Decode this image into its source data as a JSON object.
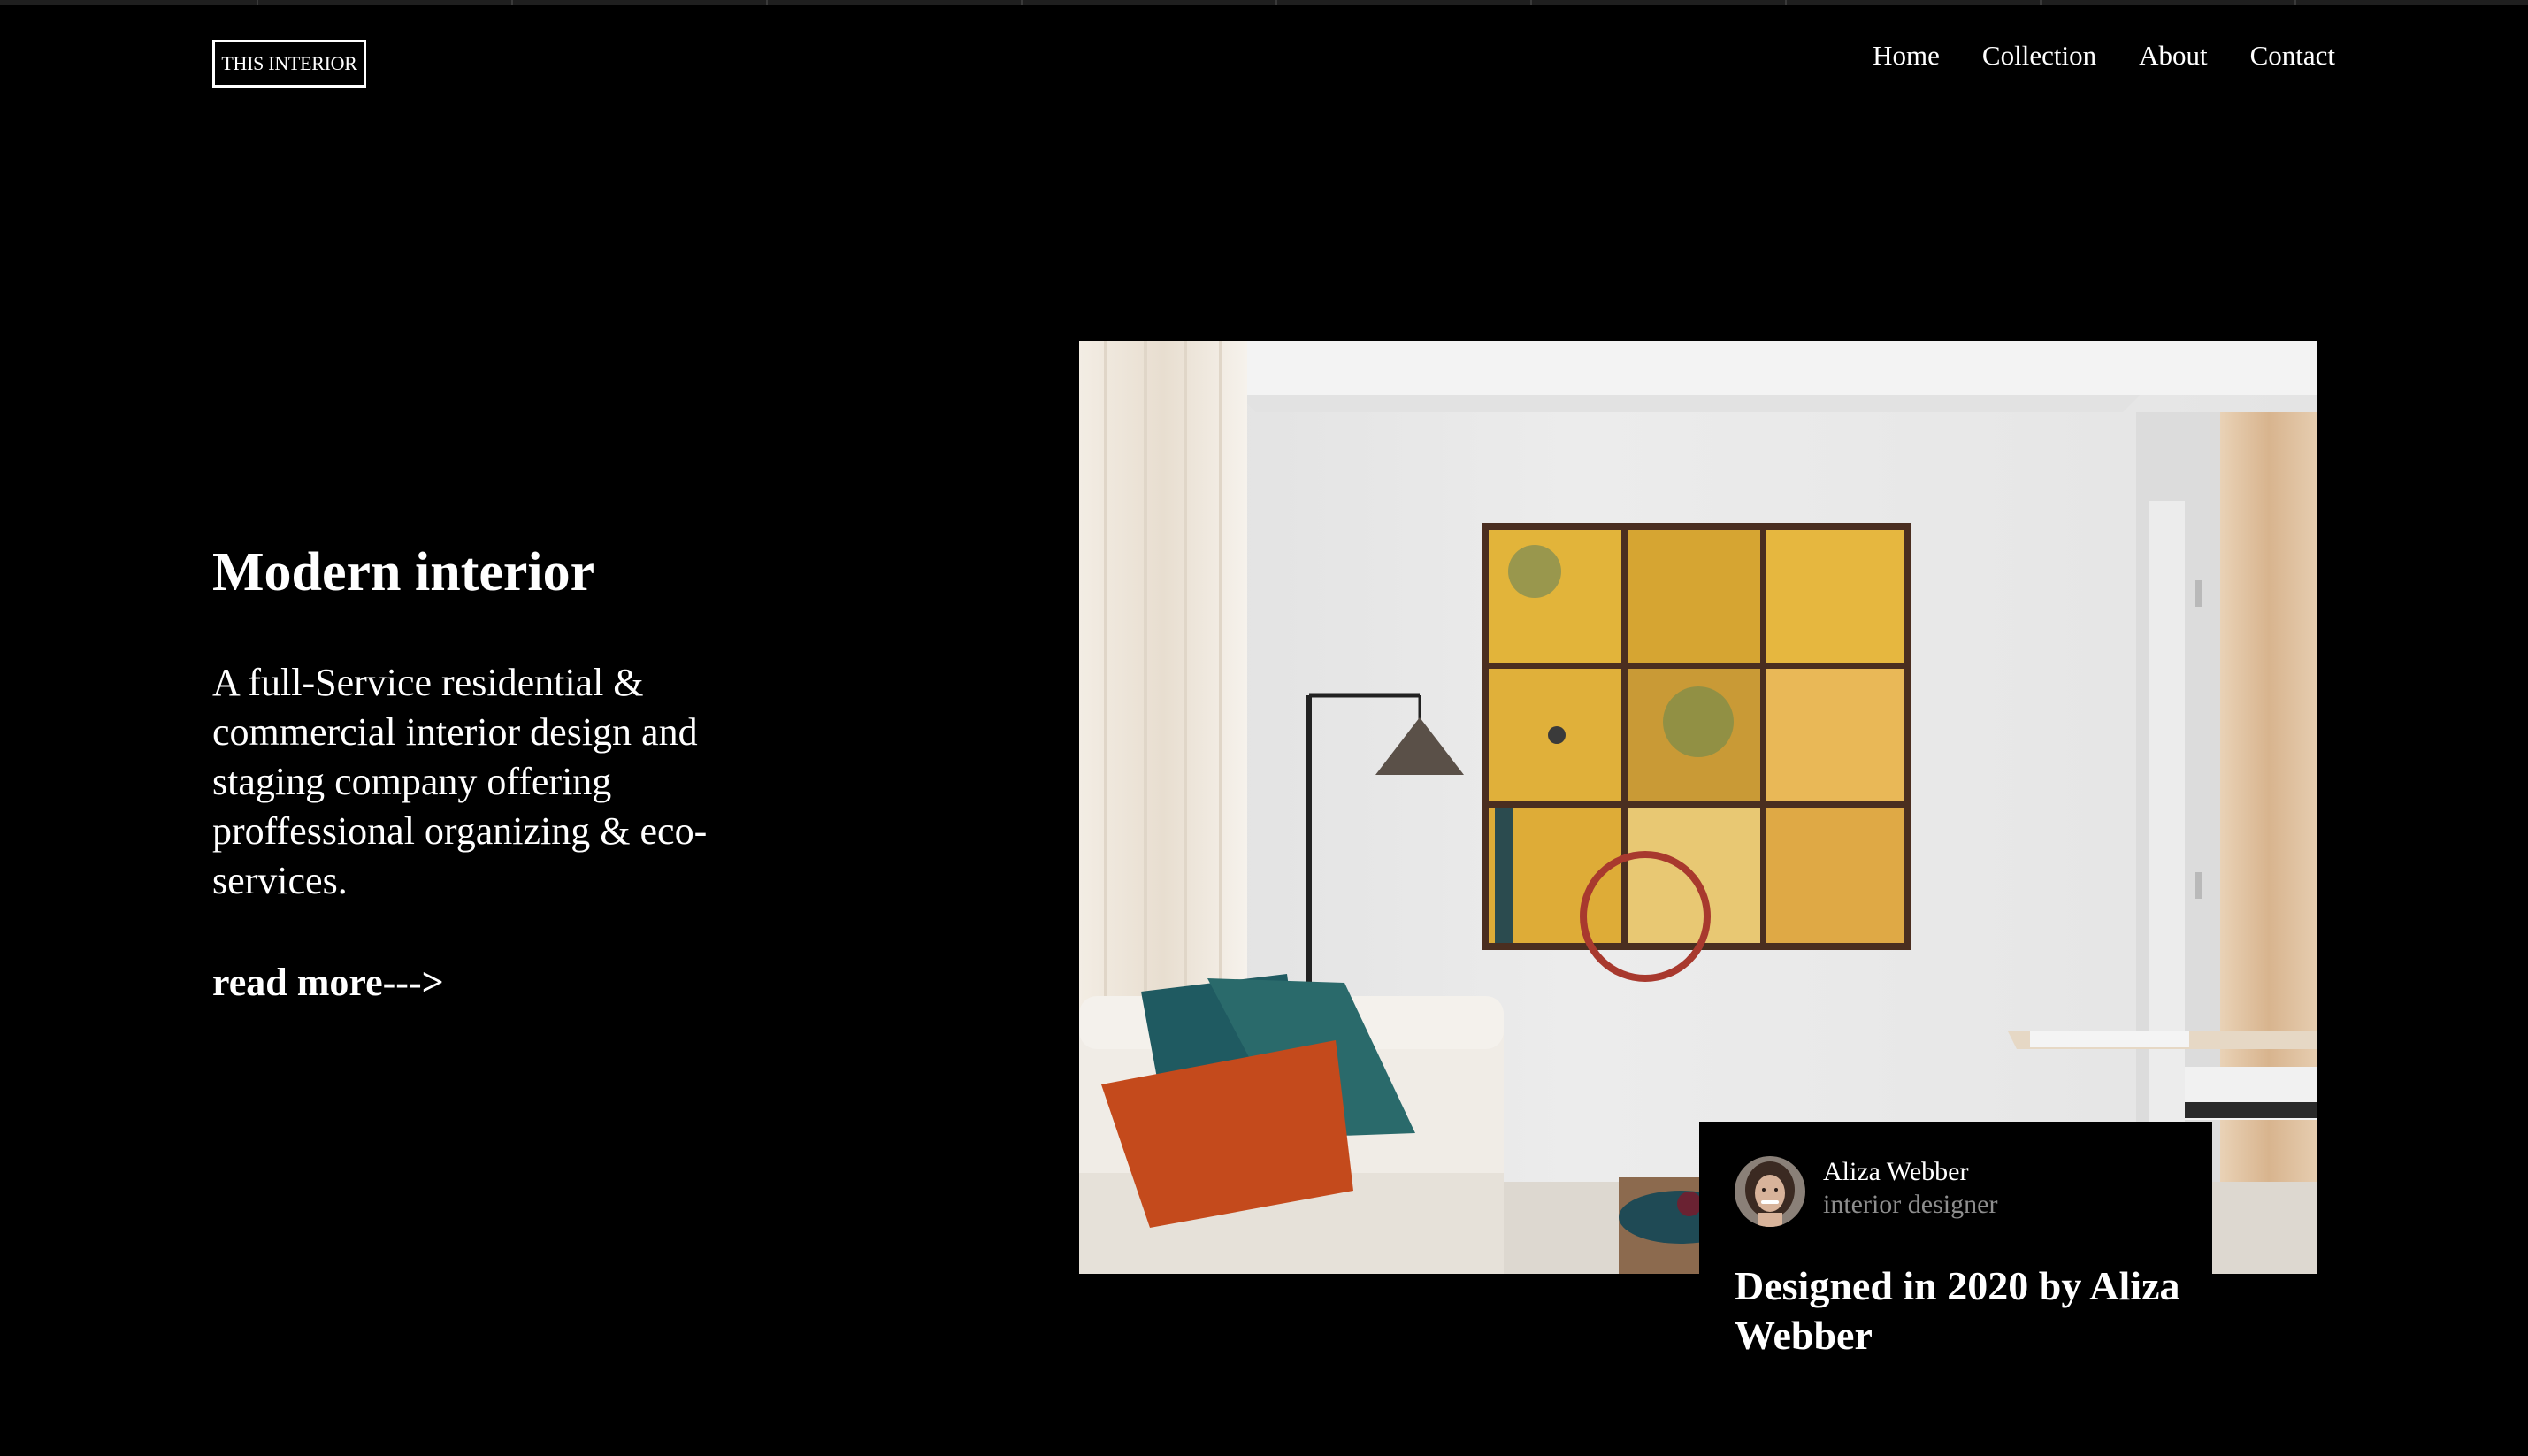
{
  "header": {
    "logo_text": "THIS INTERIOR",
    "nav": [
      "Home",
      "Collection",
      "About",
      "Contact"
    ]
  },
  "hero": {
    "title": "Modern interior",
    "description": "A full-Service residential & commercial interior design and staging company offering proffessional organizing & eco-services.",
    "read_more": "read more--->"
  },
  "credit": {
    "author_name": "Aliza Webber",
    "author_role": "interior designer",
    "designed_text": "Designed in 2020 by Aliza Webber"
  },
  "colors": {
    "background": "#000000",
    "text": "#ffffff",
    "muted_text": "#8e8e8e"
  }
}
